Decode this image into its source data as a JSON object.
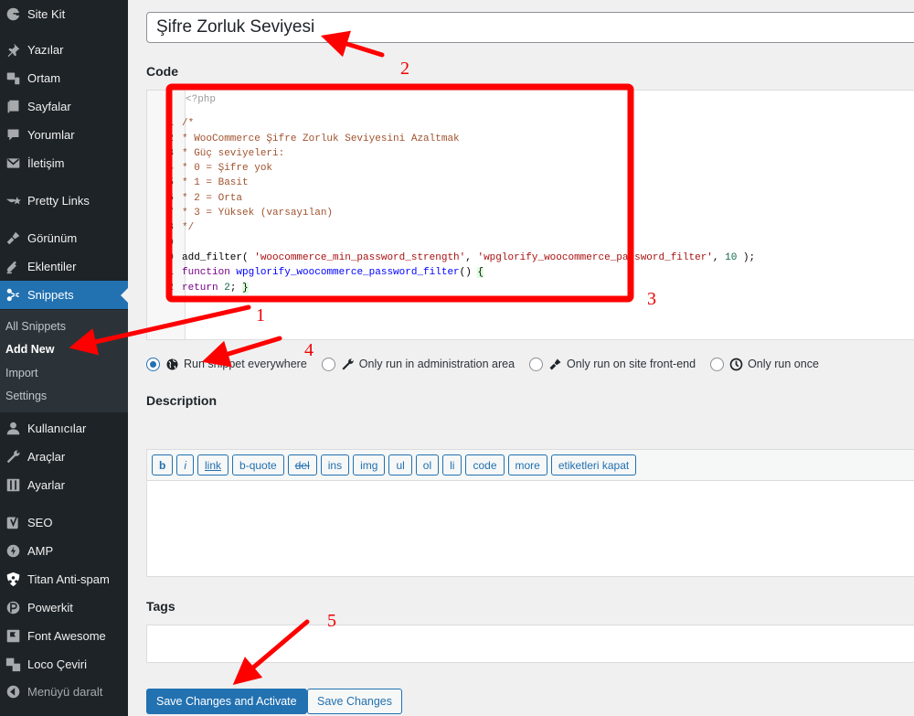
{
  "sidebar": {
    "items": [
      {
        "label": "Site Kit",
        "icon": "google-g-icon"
      },
      {
        "label": "Yazılar",
        "icon": "pin-icon"
      },
      {
        "label": "Ortam",
        "icon": "media-icon"
      },
      {
        "label": "Sayfalar",
        "icon": "pages-icon"
      },
      {
        "label": "Yorumlar",
        "icon": "comment-icon"
      },
      {
        "label": "İletişim",
        "icon": "mail-icon"
      },
      {
        "label": "Pretty Links",
        "icon": "star-link-icon"
      },
      {
        "label": "Görünüm",
        "icon": "paintbrush-icon"
      },
      {
        "label": "Eklentiler",
        "icon": "plugin-icon"
      },
      {
        "label": "Snippets",
        "icon": "scissors-icon",
        "active": true
      },
      {
        "label": "Kullanıcılar",
        "icon": "user-icon"
      },
      {
        "label": "Araçlar",
        "icon": "wrench-icon"
      },
      {
        "label": "Ayarlar",
        "icon": "settings-sliders-icon"
      },
      {
        "label": "SEO",
        "icon": "yoast-icon"
      },
      {
        "label": "AMP",
        "icon": "amp-bolt-icon"
      },
      {
        "label": "Titan Anti-spam",
        "icon": "shield-icon"
      },
      {
        "label": "Powerkit",
        "icon": "powerkit-icon"
      },
      {
        "label": "Font Awesome",
        "icon": "flag-icon"
      },
      {
        "label": "Loco Çeviri",
        "icon": "translate-icon"
      },
      {
        "label": "Menüyü daralt",
        "icon": "collapse-icon"
      }
    ],
    "submenu": [
      {
        "label": "All Snippets"
      },
      {
        "label": "Add New",
        "current": true
      },
      {
        "label": "Import"
      },
      {
        "label": "Settings"
      }
    ]
  },
  "main": {
    "title_value": "Şifre Zorluk Seviyesi",
    "code_label": "Code",
    "code": {
      "php_open": "<?php",
      "lines": [
        {
          "n": "1",
          "text": "/*",
          "type": "comment"
        },
        {
          "n": "2",
          "text": "* WooCommerce Şifre Zorluk Seviyesini Azaltmak",
          "type": "comment"
        },
        {
          "n": "3",
          "text": "* Güç seviyeleri:",
          "type": "comment"
        },
        {
          "n": "4",
          "text": "* 0 = Şifre yok",
          "type": "comment"
        },
        {
          "n": "5",
          "text": "* 1 = Basit",
          "type": "comment"
        },
        {
          "n": "6",
          "text": "* 2 = Orta",
          "type": "comment"
        },
        {
          "n": "7",
          "text": "* 3 = Yüksek (varsayılan)",
          "type": "comment"
        },
        {
          "n": "8",
          "text": "*/",
          "type": "comment"
        },
        {
          "n": "9",
          "text": "",
          "type": "blank"
        },
        {
          "n": "0",
          "tokens": [
            {
              "t": "add_filter( ",
              "c": "plain"
            },
            {
              "t": "'woocommerce_min_password_strength'",
              "c": "string"
            },
            {
              "t": ", ",
              "c": "plain"
            },
            {
              "t": "'wpglorify_woocommerce_password_filter'",
              "c": "string"
            },
            {
              "t": ", ",
              "c": "plain"
            },
            {
              "t": "10",
              "c": "number"
            },
            {
              "t": " );",
              "c": "plain"
            }
          ]
        },
        {
          "n": "1",
          "tokens": [
            {
              "t": "function ",
              "c": "keyword"
            },
            {
              "t": "wpglorify_woocommerce_password_filter",
              "c": "def"
            },
            {
              "t": "() ",
              "c": "plain"
            },
            {
              "t": "{",
              "c": "bracket"
            }
          ]
        },
        {
          "n": "2",
          "tokens": [
            {
              "t": "return ",
              "c": "keyword"
            },
            {
              "t": "2",
              "c": "number"
            },
            {
              "t": "; ",
              "c": "plain"
            },
            {
              "t": "}",
              "c": "bracket"
            }
          ]
        }
      ]
    },
    "scope_options": [
      {
        "label": "Run snippet everywhere",
        "icon": "globe-icon",
        "checked": true
      },
      {
        "label": "Only run in administration area",
        "icon": "wrench-icon",
        "checked": false
      },
      {
        "label": "Only run on site front-end",
        "icon": "paintbrush-icon",
        "checked": false
      },
      {
        "label": "Only run once",
        "icon": "clock-icon",
        "checked": false
      }
    ],
    "description_label": "Description",
    "quicktags": [
      {
        "label": "b",
        "style": "bold"
      },
      {
        "label": "i",
        "style": "italic"
      },
      {
        "label": "link",
        "style": "link"
      },
      {
        "label": "b-quote",
        "style": ""
      },
      {
        "label": "del",
        "style": "del"
      },
      {
        "label": "ins",
        "style": ""
      },
      {
        "label": "img",
        "style": ""
      },
      {
        "label": "ul",
        "style": ""
      },
      {
        "label": "ol",
        "style": ""
      },
      {
        "label": "li",
        "style": ""
      },
      {
        "label": "code",
        "style": ""
      },
      {
        "label": "more",
        "style": ""
      },
      {
        "label": "etiketleri kapat",
        "style": ""
      }
    ],
    "description_value": "",
    "tags_label": "Tags",
    "tags_value": "",
    "save_activate_label": "Save Changes and Activate",
    "save_label": "Save Changes"
  },
  "annotations": {
    "color": "#ff0000",
    "numbers": [
      "1",
      "2",
      "3",
      "4",
      "5"
    ]
  },
  "colors": {
    "accent": "#2271b1",
    "sidebar_bg": "#1d2327",
    "page_bg": "#f0f0f1"
  }
}
